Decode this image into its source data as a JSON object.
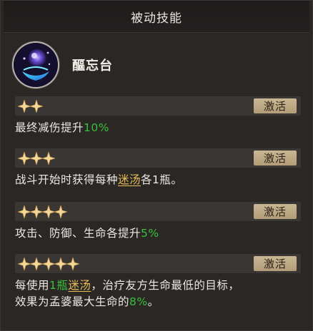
{
  "panel": {
    "title": "被动技能"
  },
  "skill": {
    "name": "醧忘台",
    "icon": "mystic-orb-icon"
  },
  "tiers": [
    {
      "stars": 2,
      "badge": "激活",
      "desc": {
        "before": "最终减伤提升",
        "value": "10%",
        "after": ""
      }
    },
    {
      "stars": 3,
      "badge": "激活",
      "desc": {
        "part1": "战斗开始时获得每种",
        "link": "迷汤",
        "part2": "各1瓶。"
      }
    },
    {
      "stars": 4,
      "badge": "激活",
      "desc": {
        "before": "攻击、防御、生命各提升",
        "value": "5%",
        "after": ""
      }
    },
    {
      "stars": 5,
      "badge": "激活",
      "desc": {
        "part1": "每使用",
        "num": "1瓶",
        "link": "迷汤",
        "part2": "，治疗友方生命最低的目标，",
        "line2": "效果为孟婆最大生命的",
        "value": "8%",
        "end": "。"
      }
    }
  ],
  "colors": {
    "highlight_green": "#37c23a",
    "link_gold": "#e8bd5a",
    "badge_bg": "#c9b693",
    "star_gold": "#f4d89a"
  }
}
